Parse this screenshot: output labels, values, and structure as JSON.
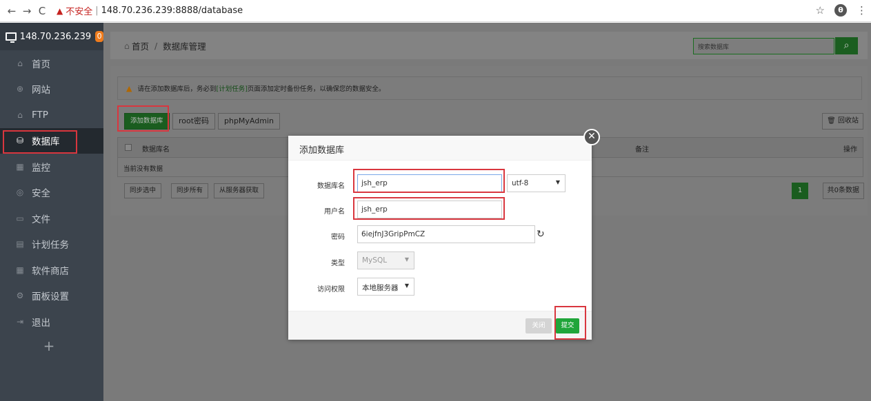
{
  "browser": {
    "back": "←",
    "forward": "→",
    "reload": "C",
    "insecure_label": "不安全",
    "separator": "|",
    "url": "148.70.236.239:8888/database",
    "star": "☆",
    "profile": "θ",
    "menu": "⋮"
  },
  "sidebar": {
    "server_ip": "148.70.236.239",
    "badge": "0",
    "items": [
      {
        "label": "首页",
        "icon": "⌂"
      },
      {
        "label": "网站",
        "icon": "⊕"
      },
      {
        "label": "FTP",
        "icon": "⌂"
      },
      {
        "label": "数据库",
        "icon": "⛁"
      },
      {
        "label": "监控",
        "icon": "▦"
      },
      {
        "label": "安全",
        "icon": "◎"
      },
      {
        "label": "文件",
        "icon": "▭"
      },
      {
        "label": "计划任务",
        "icon": "▤"
      },
      {
        "label": "软件商店",
        "icon": "▦"
      },
      {
        "label": "面板设置",
        "icon": "⚙"
      },
      {
        "label": "退出",
        "icon": "⇥"
      }
    ],
    "add": "+"
  },
  "breadcrumb": {
    "home": "首页",
    "sep": "/",
    "current": "数据库管理"
  },
  "search": {
    "placeholder": "搜索数据库",
    "icon": "⌕"
  },
  "alert": {
    "icon": "▲",
    "text_before": "请在添加数据库后，务必到",
    "link": "[计划任务]",
    "text_after": "页面添加定时备份任务，以确保您的数据安全。"
  },
  "toolbar": {
    "add_db": "添加数据库",
    "root_pwd": "root密码",
    "phpmyadmin": "phpMyAdmin",
    "recycle": "回收站",
    "recycle_icon": "🗑"
  },
  "table": {
    "col_name": "数据库名",
    "col_note": "备注",
    "col_action": "操作",
    "empty": "当前没有数据"
  },
  "bottom": {
    "sync_selected": "同步选中",
    "sync_all": "同步所有",
    "from_server": "从服务器获取",
    "page": "1",
    "total": "共0条数据"
  },
  "dialog": {
    "title": "添加数据库",
    "close_icon": "✕",
    "db_name_label": "数据库名",
    "db_name_value": "jsh_erp",
    "charset": "utf-8",
    "username_label": "用户名",
    "username_value": "jsh_erp",
    "password_label": "密码",
    "password_value": "6iejfnJ3GripPmCZ",
    "refresh_icon": "↻",
    "type_label": "类型",
    "type_value": "MySQL",
    "access_label": "访问权限",
    "access_value": "本地服务器",
    "caret": "▼",
    "close_btn": "关闭",
    "submit_btn": "提交"
  }
}
